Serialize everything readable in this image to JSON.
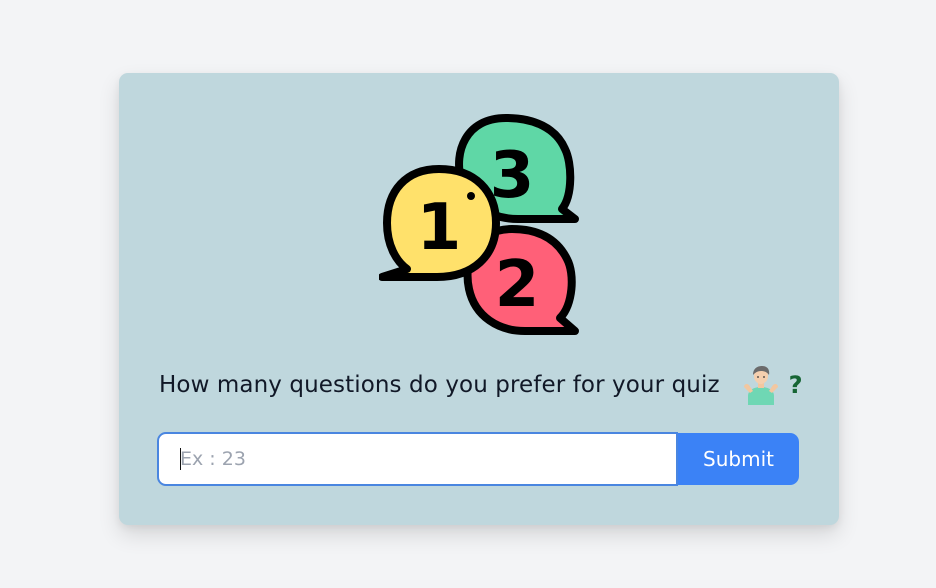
{
  "quiz_setup": {
    "question": "How many questions do you prefer for your quiz",
    "question_mark": "?",
    "illustration": {
      "icon": "numbered-speech-bubbles-icon",
      "bubble_numbers": [
        "1",
        "3",
        "2"
      ],
      "colors": {
        "bubble_1": "#ffe16b",
        "bubble_3": "#5fd7a6",
        "bubble_2": "#ff6078",
        "outline": "#000000"
      }
    },
    "shrug_icon": "person-shrugging-icon",
    "input": {
      "placeholder": "Ex : 23",
      "value": ""
    },
    "submit_label": "Submit"
  },
  "colors": {
    "page_background": "#f3f4f6",
    "card_background": "#bfd7dd",
    "accent": "#3b82f6",
    "input_border": "#4a86e0",
    "question_mark": "#166534"
  }
}
